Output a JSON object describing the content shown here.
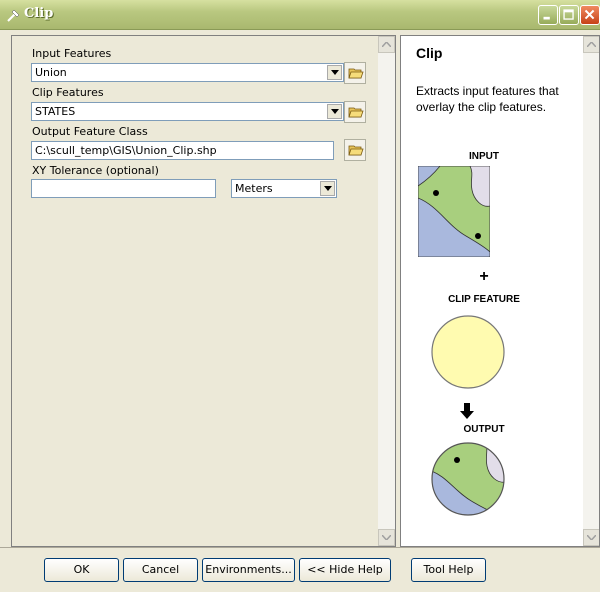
{
  "window": {
    "title": "Clip"
  },
  "params": {
    "input_features": {
      "label": "Input Features",
      "value": "Union"
    },
    "clip_features": {
      "label": "Clip Features",
      "value": "STATES"
    },
    "output_feature_class": {
      "label": "Output Feature Class",
      "value": "C:\\scull_temp\\GIS\\Union_Clip.shp"
    },
    "xy_tolerance": {
      "label": "XY Tolerance (optional)",
      "value": "",
      "unit": "Meters"
    }
  },
  "help": {
    "title": "Clip",
    "description": "Extracts input features that overlay the clip features.",
    "input_label": "INPUT",
    "plus": "+",
    "clip_label": "CLIP FEATURE",
    "output_label": "OUTPUT"
  },
  "buttons": {
    "ok": "OK",
    "cancel": "Cancel",
    "environments": "Environments...",
    "hide_help": "<< Hide Help",
    "tool_help": "Tool Help"
  },
  "colors": {
    "land_green": "#a8cf7e",
    "water_blue": "#a9b8dd",
    "light_lavender": "#e2dde9",
    "clip_yellow": "#fffbb0"
  }
}
